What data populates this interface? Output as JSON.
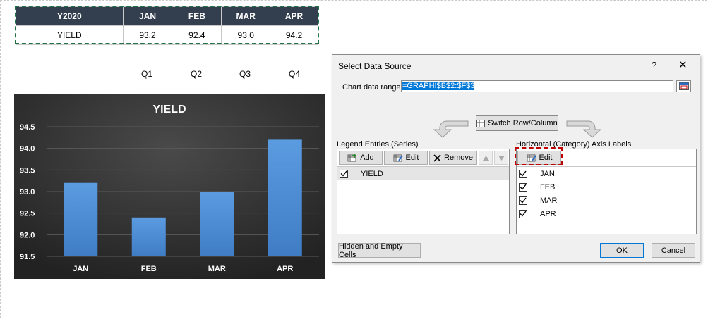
{
  "sheet": {
    "headers": [
      "Y2020",
      "JAN",
      "FEB",
      "MAR",
      "APR"
    ],
    "row": [
      "YIELD",
      "93.2",
      "92.4",
      "93.0",
      "94.2"
    ],
    "quarters": [
      "Q1",
      "Q2",
      "Q3",
      "Q4"
    ]
  },
  "chart_data": {
    "type": "bar",
    "title": "YIELD",
    "categories": [
      "JAN",
      "FEB",
      "MAR",
      "APR"
    ],
    "values": [
      93.2,
      92.4,
      93.0,
      94.2
    ],
    "ylim": [
      91.5,
      94.5
    ],
    "yticks": [
      "94.5",
      "94.0",
      "93.5",
      "93.0",
      "92.5",
      "92.0",
      "91.5"
    ],
    "grid": true,
    "bar_color": "#4f8fd5",
    "background": "#2b2b2b"
  },
  "dialog": {
    "title": "Select Data Source",
    "help": "?",
    "close": "✕",
    "range_label": "Chart data range:",
    "range_value": "=GRAPH!$B$2:$F$3",
    "switch_label": "Switch Row/Column",
    "legend_label": "Legend Entries (Series)",
    "add_label": "Add",
    "edit_label": "Edit",
    "remove_label": "Remove",
    "series": [
      "YIELD"
    ],
    "axis_label": "Horizontal (Category) Axis Labels",
    "axis_edit_label": "Edit",
    "axis_items": [
      "JAN",
      "FEB",
      "MAR",
      "APR"
    ],
    "hidden_label": "Hidden and Empty Cells",
    "ok_label": "OK",
    "cancel_label": "Cancel"
  },
  "colors": {
    "table_header": "#333f4f",
    "highlight": "#c00000",
    "accent": "#0078d7"
  }
}
